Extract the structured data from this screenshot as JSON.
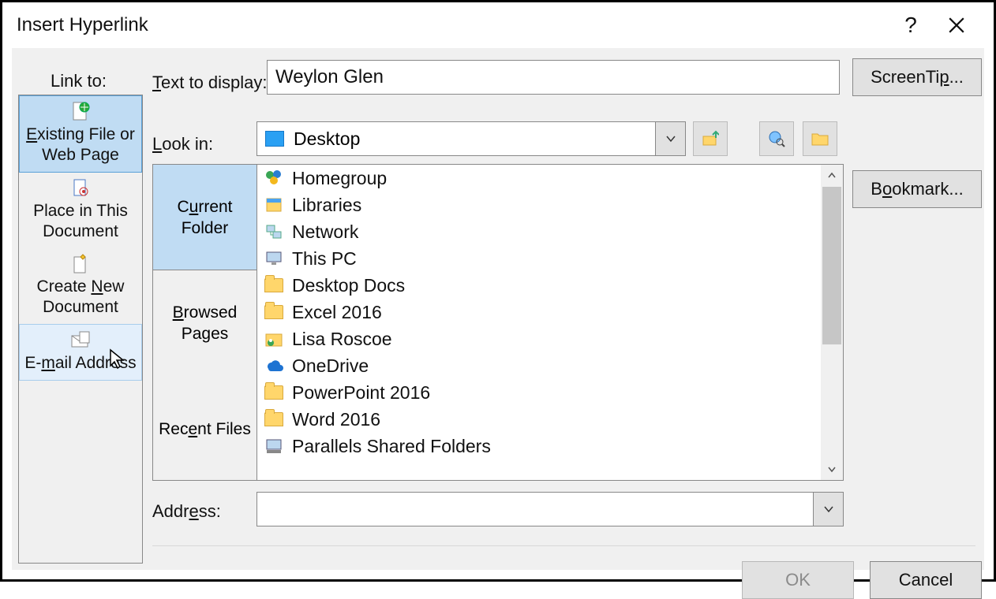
{
  "window": {
    "title": "Insert Hyperlink"
  },
  "sidebar": {
    "heading": "Link to:",
    "items": [
      {
        "line1_pre": "E",
        "line1_post": "xisting File or",
        "line2": "Web Page"
      },
      {
        "line1": "Place in This",
        "line2": "Document"
      },
      {
        "line1_pre": "Create ",
        "line1_acc": "N",
        "line1_post": "ew",
        "line2": "Document"
      },
      {
        "line1_pre": "E-",
        "line1_acc": "m",
        "line1_post": "ail Address"
      }
    ]
  },
  "fields": {
    "text_to_display_label_pre": "T",
    "text_to_display_label_post": "ext to display:",
    "text_to_display_value": "Weylon Glen",
    "lookin_label_pre": "L",
    "lookin_label_post": "ook in:",
    "lookin_value": "Desktop",
    "address_label_pre": "Addr",
    "address_label_acc": "e",
    "address_label_post": "ss:",
    "address_value": ""
  },
  "nav_tabs": {
    "current_pre": "C",
    "current_acc": "u",
    "current_post": "rrent",
    "current_line2": "Folder",
    "browsed_acc": "B",
    "browsed_post": "rowsed",
    "browsed_line2": "Pages",
    "recent_pre": "Rec",
    "recent_acc": "e",
    "recent_post": "nt Files"
  },
  "file_items": [
    {
      "icon": "homegroup",
      "label": "Homegroup"
    },
    {
      "icon": "libraries",
      "label": "Libraries"
    },
    {
      "icon": "network",
      "label": "Network"
    },
    {
      "icon": "thispc",
      "label": "This PC"
    },
    {
      "icon": "folder",
      "label": "Desktop Docs"
    },
    {
      "icon": "folder",
      "label": "Excel 2016"
    },
    {
      "icon": "userfolder",
      "label": "Lisa Roscoe"
    },
    {
      "icon": "onedrive",
      "label": "OneDrive"
    },
    {
      "icon": "folder",
      "label": "PowerPoint 2016"
    },
    {
      "icon": "folder",
      "label": "Word 2016"
    },
    {
      "icon": "drive",
      "label": "Parallels Shared Folders"
    }
  ],
  "buttons": {
    "screentip_pre": "ScreenTi",
    "screentip_acc": "p",
    "screentip_post": "...",
    "bookmark_pre": "B",
    "bookmark_acc": "o",
    "bookmark_post": "okmark...",
    "ok": "OK",
    "cancel": "Cancel"
  }
}
